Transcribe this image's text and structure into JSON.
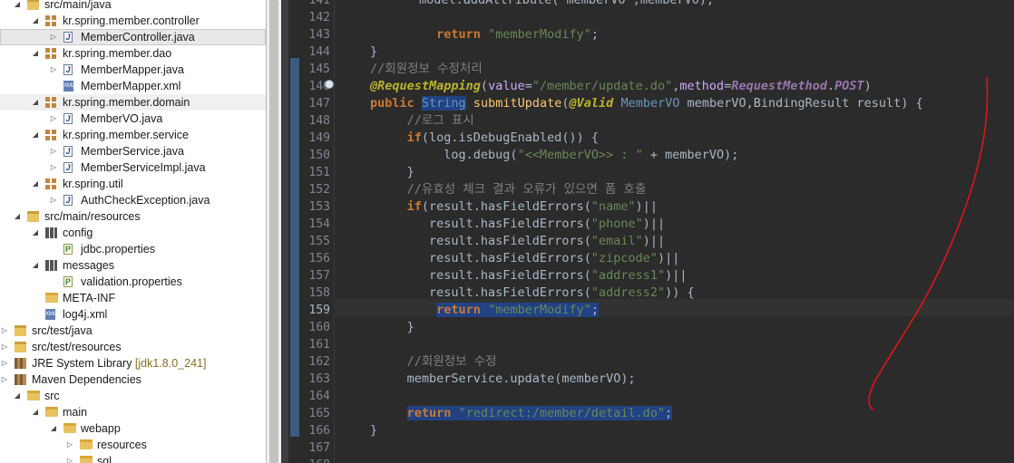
{
  "explorer": {
    "rows": [
      {
        "label": "src/main/java",
        "extra": "",
        "icon": "source-folder-icon"
      },
      {
        "label": "kr.spring.member.controller",
        "extra": "",
        "icon": "package-icon"
      },
      {
        "label": "MemberController.java",
        "extra": "",
        "icon": "java-file-icon"
      },
      {
        "label": "kr.spring.member.dao",
        "extra": "",
        "icon": "package-icon"
      },
      {
        "label": "MemberMapper.java",
        "extra": "",
        "icon": "java-interface-icon"
      },
      {
        "label": "MemberMapper.xml",
        "extra": "",
        "icon": "xml-file-icon"
      },
      {
        "label": "kr.spring.member.domain",
        "extra": "",
        "icon": "package-icon"
      },
      {
        "label": "MemberVO.java",
        "extra": "",
        "icon": "java-file-icon"
      },
      {
        "label": "kr.spring.member.service",
        "extra": "",
        "icon": "package-icon"
      },
      {
        "label": "MemberService.java",
        "extra": "",
        "icon": "java-interface-icon"
      },
      {
        "label": "MemberServiceImpl.java",
        "extra": "",
        "icon": "java-file-icon"
      },
      {
        "label": "kr.spring.util",
        "extra": "",
        "icon": "package-icon"
      },
      {
        "label": "AuthCheckException.java",
        "extra": "",
        "icon": "java-file-icon"
      },
      {
        "label": "src/main/resources",
        "extra": "",
        "icon": "source-folder-icon"
      },
      {
        "label": "config",
        "extra": "",
        "icon": "config-package-icon"
      },
      {
        "label": "jdbc.properties",
        "extra": "",
        "icon": "properties-file-icon"
      },
      {
        "label": "messages",
        "extra": "",
        "icon": "config-package-icon"
      },
      {
        "label": "validation.properties",
        "extra": "",
        "icon": "properties-file-icon"
      },
      {
        "label": "META-INF",
        "extra": "",
        "icon": "folder-icon"
      },
      {
        "label": "log4j.xml",
        "extra": "",
        "icon": "xml-file-icon"
      },
      {
        "label": "src/test/java",
        "extra": "",
        "icon": "source-folder-icon"
      },
      {
        "label": "src/test/resources",
        "extra": "",
        "icon": "source-folder-icon"
      },
      {
        "label": "JRE System Library ",
        "extra": "[jdk1.8.0_241]",
        "icon": "library-icon"
      },
      {
        "label": "Maven Dependencies",
        "extra": "",
        "icon": "library-icon"
      },
      {
        "label": "src",
        "extra": "",
        "icon": "folder-icon"
      },
      {
        "label": "main",
        "extra": "",
        "icon": "folder-icon"
      },
      {
        "label": "webapp",
        "extra": "",
        "icon": "folder-icon"
      },
      {
        "label": "resources",
        "extra": "",
        "icon": "folder-icon"
      },
      {
        "label": "sql",
        "extra": "",
        "icon": "folder-icon"
      }
    ]
  },
  "editor": {
    "line_numbers": [
      "141",
      "142",
      "143",
      "144",
      "145",
      "146",
      "147",
      "148",
      "149",
      "150",
      "151",
      "152",
      "153",
      "154",
      "155",
      "156",
      "157",
      "158",
      "159",
      "160",
      "161",
      "162",
      "163",
      "164",
      "165",
      "166",
      "167",
      "168"
    ],
    "lines": {
      "l141": "model.addAttribute(\"memberVO\",memberVO);",
      "l143_kw": "return",
      "l143_str": "\"memberModify\"",
      "l145": "//회원정보 수정처리",
      "l146_ann": "@RequestMapping",
      "l146_p1": "value",
      "l146_s1": "\"/member/update.do\"",
      "l146_p2": "method",
      "l146_cls": "RequestMethod",
      "l146_en": "POST",
      "l147_kw": "public",
      "l147_type": "String",
      "l147_fn": "submitUpdate",
      "l147_ann": "@Valid",
      "l147_t2": "MemberVO",
      "l147_rest1": " memberVO,BindingResult result) {",
      "l148": "//로그 표시",
      "l149_kw": "if",
      "l149_rest": "(log.isDebugEnabled()) {",
      "l150_a": "log.debug(",
      "l150_s": "\"<<MemberVO>> : \"",
      "l150_b": " + memberVO);",
      "l152": "//유효성 체크 결과 오류가 있으면 폼 호출",
      "l153_a": "(result.hasFieldErrors(",
      "l153_s": "\"name\"",
      "l154_s": "\"phone\"",
      "l155_s": "\"email\"",
      "l156_s": "\"zipcode\"",
      "l157_s": "\"address1\"",
      "l158_s": "\"address2\"",
      "l162": "//회원정보 수정",
      "l163": "memberService.update(memberVO);",
      "l165_str": "\"redirect:/member/detail.do\""
    }
  },
  "colors": {
    "annotation_stroke": "#e0141a",
    "selection": "#214283"
  }
}
